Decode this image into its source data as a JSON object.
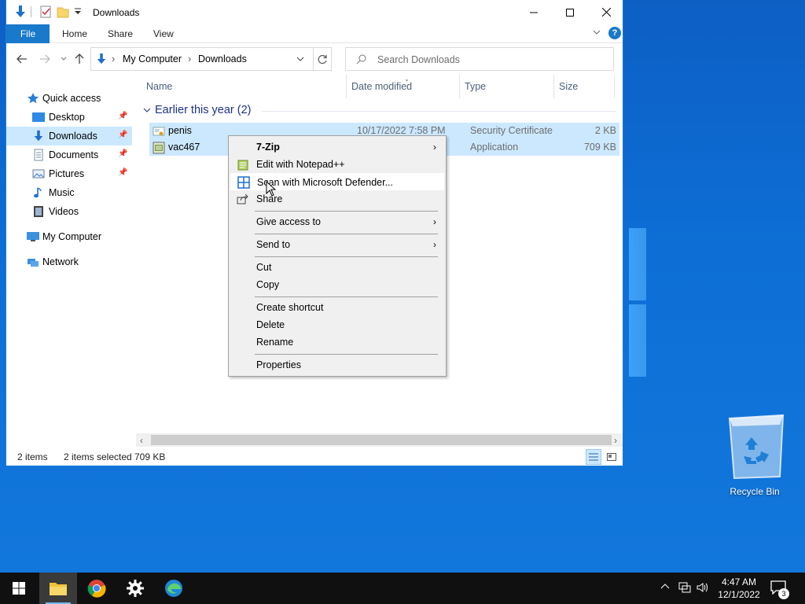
{
  "window": {
    "title": "Downloads",
    "tabs": {
      "file": "File",
      "home": "Home",
      "share": "Share",
      "view": "View"
    },
    "help": "?"
  },
  "address": {
    "crumbs": [
      "My Computer",
      "Downloads"
    ],
    "search_placeholder": "Search Downloads"
  },
  "nav": {
    "quick_access": "Quick access",
    "items": [
      {
        "label": "Desktop",
        "pinned": true
      },
      {
        "label": "Downloads",
        "pinned": true,
        "selected": true
      },
      {
        "label": "Documents",
        "pinned": true
      },
      {
        "label": "Pictures",
        "pinned": true
      },
      {
        "label": "Music"
      },
      {
        "label": "Videos"
      }
    ],
    "my_computer": "My Computer",
    "network": "Network"
  },
  "columns": {
    "name": "Name",
    "date": "Date modified",
    "type": "Type",
    "size": "Size"
  },
  "group": {
    "title": "Earlier this year (2)"
  },
  "files": [
    {
      "name": "penis",
      "date": "10/17/2022 7:58 PM",
      "type": "Security Certificate",
      "size": "2 KB"
    },
    {
      "name": "vac467",
      "date": "",
      "type": "Application",
      "size": "709 KB"
    }
  ],
  "status": {
    "count": "2 items",
    "selected": "2 items selected",
    "size": "709 KB"
  },
  "context_menu": {
    "items": [
      "7-Zip",
      "Edit with Notepad++",
      "Scan with Microsoft Defender...",
      "Share",
      "Give access to",
      "Send to",
      "Cut",
      "Copy",
      "Create shortcut",
      "Delete",
      "Rename",
      "Properties"
    ]
  },
  "desktop": {
    "recycle_bin": "Recycle Bin"
  },
  "taskbar": {
    "time": "4:47 AM",
    "date": "12/1/2022",
    "notifications": "3"
  },
  "colors": {
    "accent": "#0078d7",
    "selection": "#cce8ff",
    "file_tab": "#1979ca"
  }
}
